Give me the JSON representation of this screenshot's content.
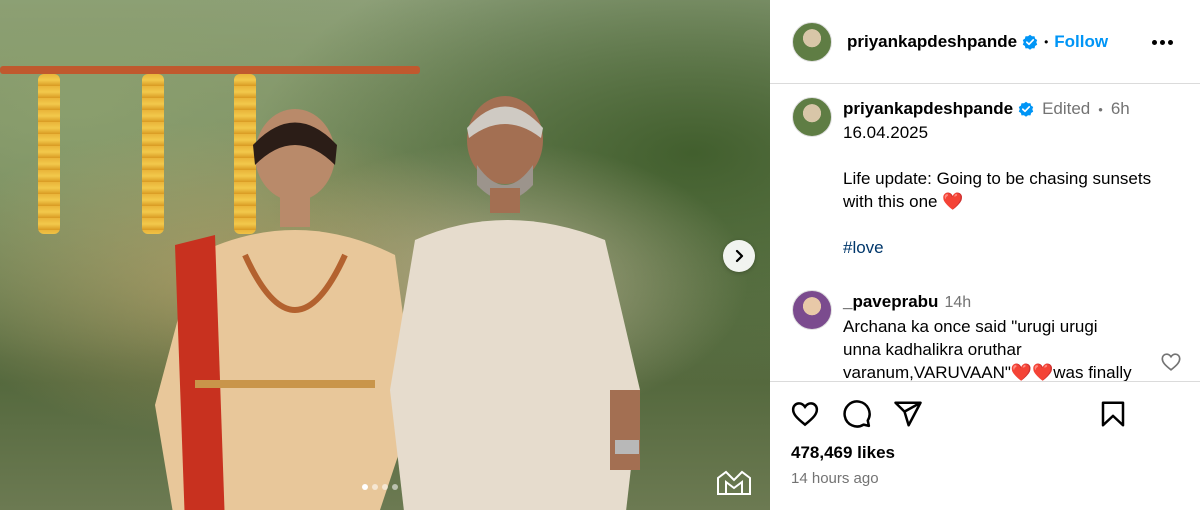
{
  "media": {
    "next_icon": "chevron-right-icon",
    "carousel_dots": 4,
    "carousel_active_index": 1,
    "watermark_icon": "photographer-logo-icon"
  },
  "header": {
    "username": "priyankapdeshpande",
    "separator": "•",
    "follow_label": "Follow",
    "more_icon": "more-horizontal-icon"
  },
  "caption": {
    "username": "priyankapdeshpande",
    "edited_label": "Edited",
    "separator": "•",
    "time": "6h",
    "date_line": "16.04.2025",
    "body_line1": "Life update: Going to be chasing sunsets",
    "body_line2": "with this one",
    "emoji": "❤️",
    "hashtag": "#love"
  },
  "comment": {
    "username": "_paveprabu",
    "time": "14h",
    "line1": "Archana ka once said \"urugi urugi",
    "line2": "unna kadhalikra oruthar",
    "line3_a": "varanum,VARUVAAN\"",
    "emoji": "❤️",
    "line3_b": "was finally"
  },
  "footer": {
    "likes": "478,469 likes",
    "time_ago": "14 hours ago"
  },
  "colors": {
    "link_blue": "#0095f6",
    "hashtag_blue": "#00376b",
    "muted": "#737373",
    "border": "#dbdbdb",
    "heart_red": "#e0245e"
  }
}
